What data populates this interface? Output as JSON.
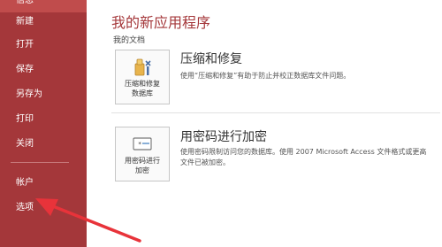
{
  "nav": {
    "top_item": "信息",
    "items": [
      "新建",
      "打开",
      "保存",
      "另存为",
      "打印",
      "关闭",
      "帐户",
      "选项"
    ]
  },
  "main": {
    "title": "我的新应用程序",
    "section": "我的文档",
    "compact": {
      "tile_label_1": "压缩和修复",
      "tile_label_2": "数据库",
      "title": "压缩和修复",
      "desc": "使用“压缩和修复”有助于防止并校正数据库文件问题。"
    },
    "encrypt": {
      "tile_label_1": "用密码进行",
      "tile_label_2": "加密",
      "title": "用密码进行加密",
      "desc_line1": "使用密码限制访问您的数据库。使用 2007 Microsoft Access 文件格式或更高",
      "desc_line2": "文件已被加密。"
    }
  },
  "colors": {
    "nav_bg": "#a4373a",
    "title": "#a4373a",
    "arrow": "#e8333a"
  }
}
